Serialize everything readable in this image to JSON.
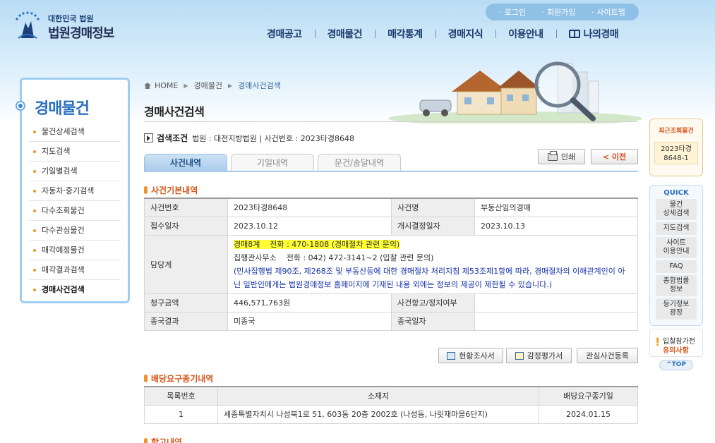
{
  "header": {
    "logo_sub": "대한민국 법원",
    "logo_main": "법원경매정보",
    "util_links": [
      "로그인",
      "회원가입",
      "사이트맵"
    ],
    "gnb": [
      "경매공고",
      "경매물건",
      "매각통계",
      "경매지식",
      "이용안내",
      "나의경매"
    ]
  },
  "sidebar": {
    "title": "경매물건",
    "items": [
      "물건상세검색",
      "지도검색",
      "기일별검색",
      "자동차·중기검색",
      "다수조회물건",
      "다수관심물건",
      "매각예정물건",
      "매각결과검색",
      "경매사건검색"
    ],
    "active_index": 8
  },
  "breadcrumb": [
    "HOME",
    "경매물건",
    "경매사건검색"
  ],
  "page_title": "경매사건검색",
  "search_condition": {
    "label": "검색조건",
    "value": "법원 : 대전지방법원 | 사건번호 : 2023타경8648"
  },
  "tabs": [
    "사건내역",
    "기일내역",
    "문건/송달내역"
  ],
  "buttons": {
    "print": "인쇄",
    "prev": "< 이전",
    "survey": "현황조사서",
    "appraisal": "감정평가서",
    "interest": "관심사건등록"
  },
  "case_basic": {
    "title": "사건기본내역",
    "case_no_label": "사건번호",
    "case_no": "2023타경8648",
    "case_name_label": "사건명",
    "case_name": "부동산임의경매",
    "receipt_date_label": "접수일자",
    "receipt_date": "2023.10.12",
    "start_date_label": "개시결정일자",
    "start_date": "2023.10.13",
    "dept_label": "담당계",
    "dept_line1": "경매8계    전화 : 470-1808 (경매절차 관련 문의)",
    "dept_line2": "집행관사무소    전화 : 042) 472-3141~2 (입찰 관련 문의)",
    "dept_notice": "(민사집행법 제90조, 제268조 및 부동산등에 대한 경매절차 처리지침 제53조제1항에 따라, 경매절차의 이해관계인이 아닌 일반인에게는 법원경매정보 홈페이지에 기재된 내용 외에는 정보의 제공이 제한될 수 있습니다.)",
    "claim_label": "청구금액",
    "claim": "446,571,763원",
    "appeal_label": "사건항고/정지여부",
    "appeal": "",
    "result_label": "종국결과",
    "result": "미종국",
    "end_date_label": "종국일자",
    "end_date": ""
  },
  "dividend": {
    "title": "배당요구종기내역",
    "headers": [
      "목록번호",
      "소재지",
      "배당요구종기일"
    ],
    "rows": [
      [
        "1",
        "세종특별자치시 나성북1로 51, 603동 20층 2002호 (나성동, 나릿재마을6단지)",
        "2024.01.15"
      ]
    ]
  },
  "next_section_title": "항고내역",
  "right_menu": {
    "recent_title": "최근조회물건",
    "recent_item": "2023타경8648-1",
    "quick_title": "QUICK",
    "quick_items": [
      "물건\n상세검색",
      "지도검색",
      "사이트\n이용안내",
      "FAQ",
      "종합법률\n정보",
      "등기정보\n광장"
    ],
    "bid_guide_l1": "입찰참가전",
    "bid_guide_l2": "유의사항",
    "top": "^TOP"
  },
  "colors": {
    "accent_orange": "#d4561c",
    "brand_blue": "#2a6fc0",
    "highlight": "#ffff33"
  }
}
